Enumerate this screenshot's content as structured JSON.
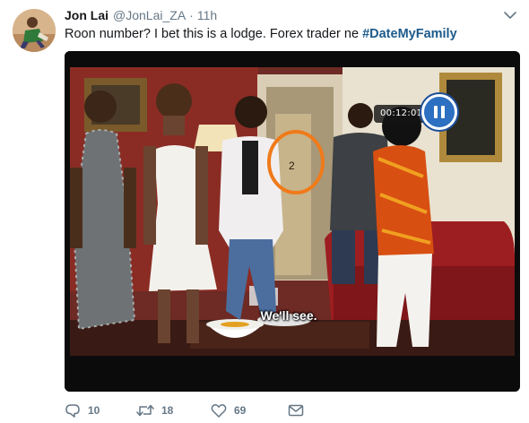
{
  "author": {
    "display_name": "Jon Lai",
    "handle": "@JonLai_ZA",
    "separator": "·",
    "time": "11h"
  },
  "tweet": {
    "text": "Roon number? I bet this is a lodge. Forex trader ne ",
    "hashtag": "#DateMyFamily"
  },
  "media": {
    "timer": "00:12:01",
    "subtitle": "We'll see.",
    "door_number": "2",
    "circle_color": "#f07a1a"
  },
  "actions": {
    "reply_count": "10",
    "retweet_count": "18",
    "like_count": "69"
  },
  "icons": {
    "avatar": "avatar",
    "caret": "chevron-down-icon",
    "reply": "reply-icon",
    "retweet": "retweet-icon",
    "like": "heart-icon",
    "message": "envelope-icon"
  }
}
